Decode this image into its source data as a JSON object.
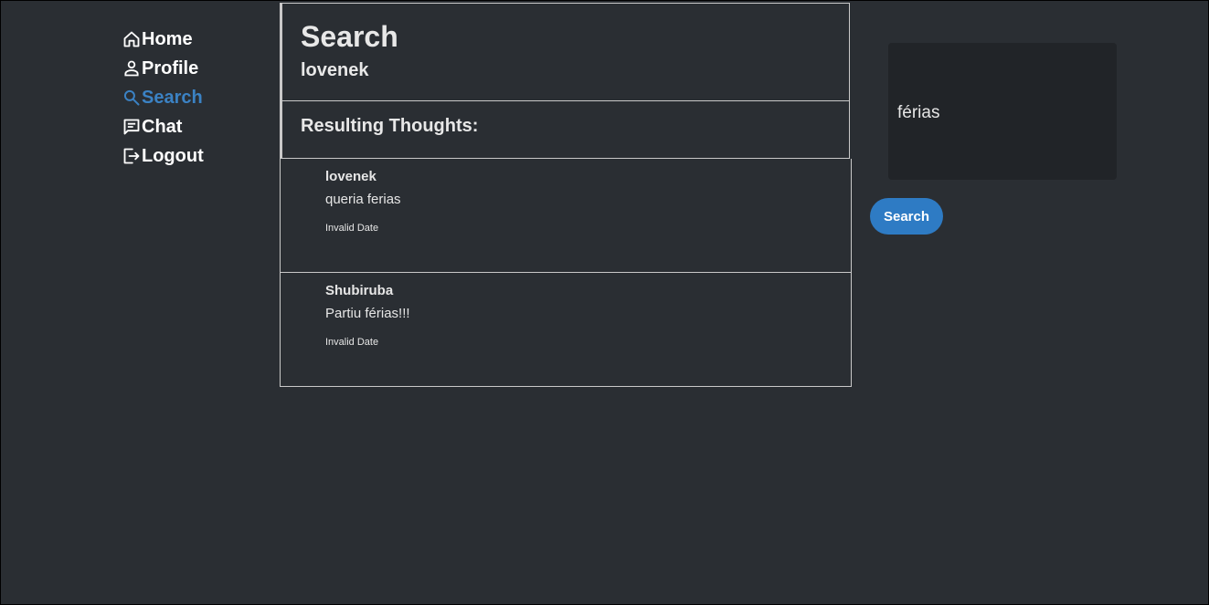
{
  "sidebar": {
    "items": [
      {
        "label": "Home",
        "icon": "home-icon",
        "active": false
      },
      {
        "label": "Profile",
        "icon": "person-icon",
        "active": false
      },
      {
        "label": "Search",
        "icon": "search-icon",
        "active": true
      },
      {
        "label": "Chat",
        "icon": "chat-icon",
        "active": false
      },
      {
        "label": "Logout",
        "icon": "logout-icon",
        "active": false
      }
    ]
  },
  "header": {
    "title": "Search",
    "search_term": "lovenek"
  },
  "results": {
    "title": "Resulting Thoughts:",
    "thoughts": [
      {
        "author": "lovenek",
        "text": "queria ferias",
        "date": "Invalid Date"
      },
      {
        "author": "Shubiruba",
        "text": "Partiu férias!!!",
        "date": "Invalid Date"
      }
    ]
  },
  "search_panel": {
    "input_value": "férias",
    "button_label": "Search"
  },
  "colors": {
    "background": "#2a2e33",
    "panel": "#212428",
    "accent": "#2e7bc4",
    "active_nav": "#3b82c4"
  }
}
